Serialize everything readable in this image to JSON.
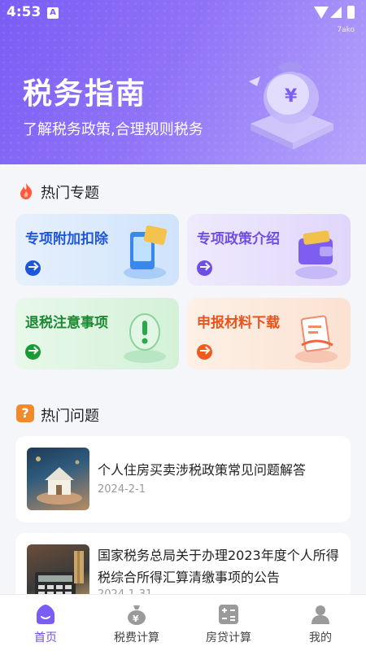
{
  "status_bar": {
    "time": "4:53",
    "badge": "A",
    "watermark": "7ako"
  },
  "hero": {
    "title": "税务指南",
    "subtitle": "了解税务政策,合理规则税务"
  },
  "sections": {
    "topics_title": "热门专题",
    "questions_title": "热门问题"
  },
  "topics": [
    {
      "label": "专项附加扣除",
      "color": "#1e56d9"
    },
    {
      "label": "专项政策介绍",
      "color": "#6e4fe0"
    },
    {
      "label": "退税注意事项",
      "color": "#1a8a32"
    },
    {
      "label": "申报材料下载",
      "color": "#e8541c"
    }
  ],
  "articles": [
    {
      "title": "个人住房买卖涉税政策常见问题解答",
      "date": "2024-2-1"
    },
    {
      "title": "国家税务总局关于办理2023年度个人所得税综合所得汇算清缴事项的公告",
      "date": "2024-1-31"
    }
  ],
  "nav": [
    {
      "label": "首页",
      "icon": "home-icon",
      "active": true
    },
    {
      "label": "税费计算",
      "icon": "money-bag-icon",
      "active": false
    },
    {
      "label": "房贷计算",
      "icon": "calculator-icon",
      "active": false
    },
    {
      "label": "我的",
      "icon": "profile-icon",
      "active": false
    }
  ],
  "colors": {
    "accent": "#6e4fe0",
    "hero_start": "#7b5cf5",
    "hero_end": "#b7a6fb"
  }
}
